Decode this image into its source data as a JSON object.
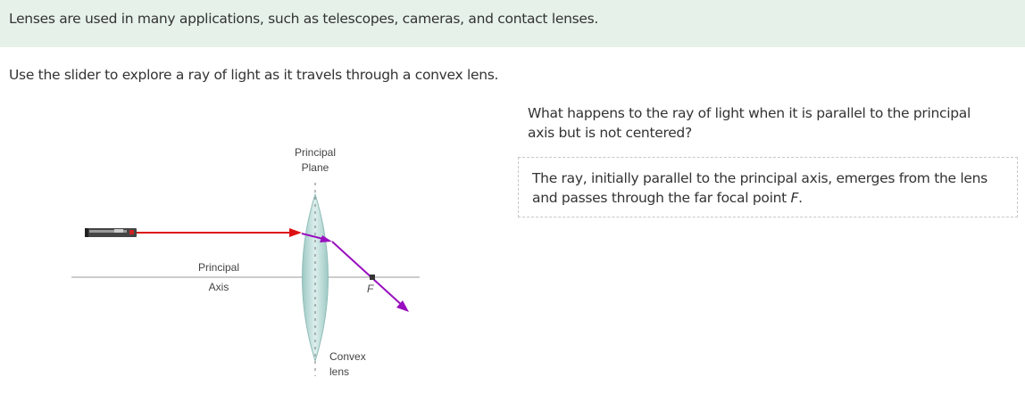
{
  "banner": {
    "text": "Lenses are used in many applications, such as telescopes, cameras, and contact lenses."
  },
  "instruction": {
    "text": "Use the slider to explore a ray of light as it travels through a convex lens."
  },
  "diagram": {
    "principal_plane_label_line1": "Principal",
    "principal_plane_label_line2": "Plane",
    "principal_axis_label_line1": "Principal",
    "principal_axis_label_line2": "Axis",
    "focal_point_label": "F",
    "lens_label_line1": "Convex",
    "lens_label_line2": "lens",
    "colors": {
      "incident_ray": "#dd1111",
      "refracted_ray": "#990fbf",
      "lens_fill": "#b5d8d4",
      "axis_line": "#999999"
    },
    "icons": [
      "laser-pointer-icon",
      "convex-lens-icon",
      "focal-point-icon"
    ]
  },
  "question": {
    "text": "What happens to the ray of light when it is parallel to the principal axis but is not centered?"
  },
  "answer": {
    "text_before_f": "The ray, initially parallel to the principal axis, emerges from the lens and passes through the far focal point ",
    "focal_symbol": "F",
    "text_after_f": "."
  }
}
